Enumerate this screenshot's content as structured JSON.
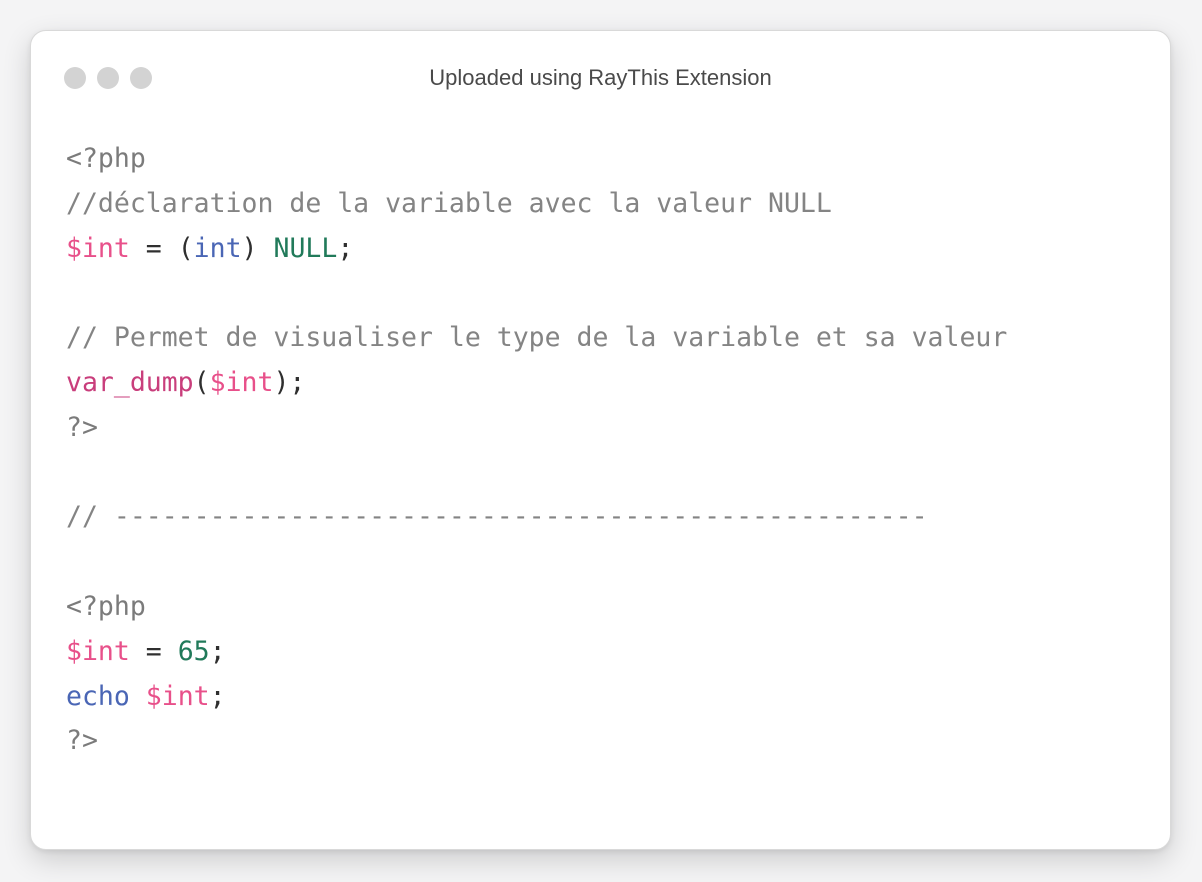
{
  "window": {
    "title": "Uploaded using RayThis Extension"
  },
  "code": {
    "line1": {
      "open_tag": "<?php"
    },
    "line2": {
      "comment": "//déclaration de la variable avec la valeur NULL"
    },
    "line3": {
      "var": "$int",
      "assign": " = ",
      "paren_open": "(",
      "type": "int",
      "paren_close": ")",
      "space": " ",
      "const": "NULL",
      "semi": ";"
    },
    "line5": {
      "comment": "// Permet de visualiser le type de la variable et sa valeur"
    },
    "line6": {
      "fn": "var_dump",
      "paren_open": "(",
      "var": "$int",
      "paren_close": ")",
      "semi": ";"
    },
    "line7": {
      "close_tag": "?>"
    },
    "line9": {
      "comment": "// ---------------------------------------------------"
    },
    "line11": {
      "open_tag": "<?php"
    },
    "line12": {
      "var": "$int",
      "assign": " = ",
      "num": "65",
      "semi": ";"
    },
    "line13": {
      "kw": "echo",
      "space": " ",
      "var": "$int",
      "semi": ";"
    },
    "line14": {
      "close_tag": "?>"
    }
  },
  "colors": {
    "variable": "#e8508a",
    "type": "#4a66b5",
    "constant": "#217a5a",
    "comment": "#848484",
    "function": "#c93e7c"
  }
}
